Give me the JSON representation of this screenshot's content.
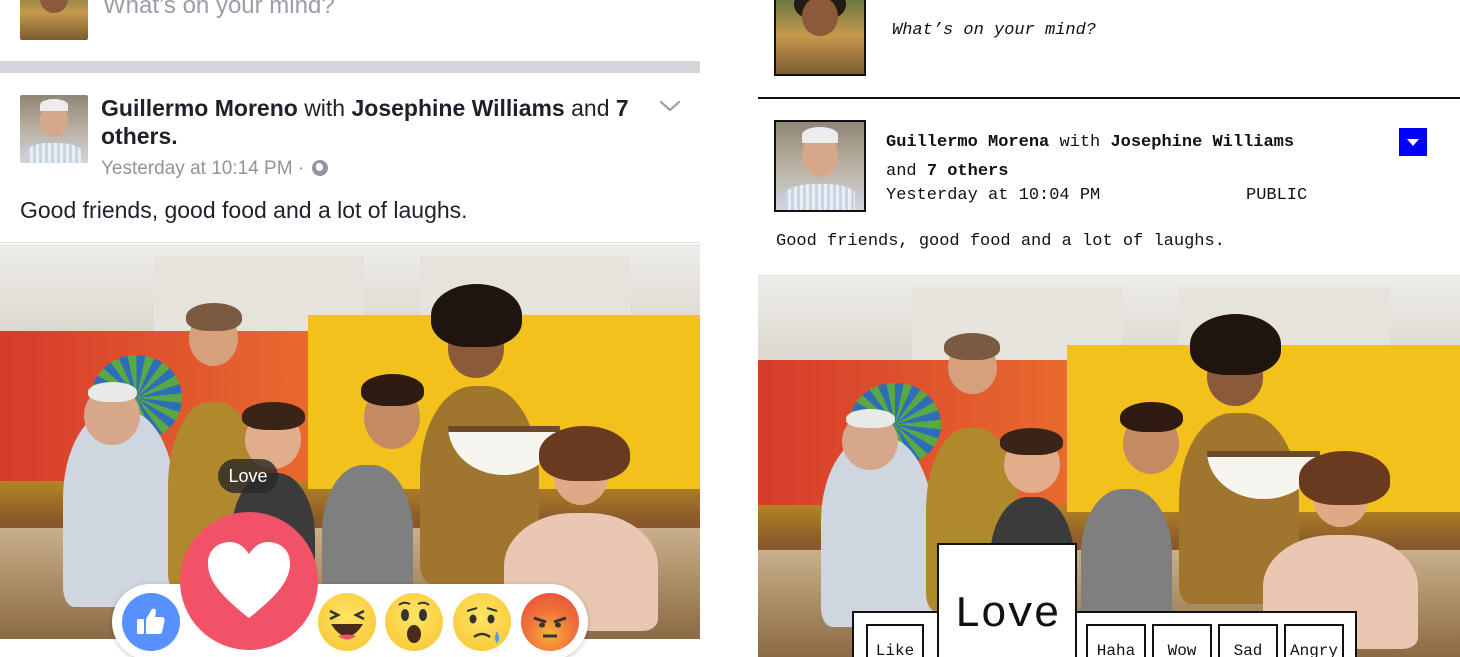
{
  "left": {
    "composer": {
      "placeholder": "What’s on your mind?"
    },
    "post": {
      "author": "Guillermo Moreno",
      "with_word": "with",
      "tagged": "Josephine Williams",
      "and_word": "and",
      "others": "7 others.",
      "timestamp": "Yesterday at 10:14 PM",
      "separator": "·",
      "privacy_icon": "globe-icon",
      "text": "Good friends, good food and a lot of laughs.",
      "menu_icon": "chevron-down-icon"
    },
    "reactions": {
      "tooltip": "Love",
      "items": [
        "like",
        "love",
        "haha",
        "wow",
        "sad",
        "angry"
      ],
      "colors": {
        "like": "#5890ff",
        "love": "#f25268",
        "face": "#f7c431",
        "angry": "#e64a3a"
      }
    }
  },
  "right": {
    "composer": {
      "placeholder": "What’s on your mind?"
    },
    "post": {
      "author": "Guillermo Morena",
      "with_word": "with",
      "tagged": "Josephine Williams",
      "and_word": "and",
      "others": "7 others",
      "timestamp": "Yesterday at 10:04 PM",
      "privacy": "PUBLIC",
      "text": "Good friends, good food and a lot of laughs.",
      "menu_color": "#0000ff"
    },
    "reactions": {
      "like": "Like",
      "love": "Love",
      "haha": "Haha",
      "wow": "Wow",
      "sad": "Sad",
      "angry": "Angry"
    }
  }
}
